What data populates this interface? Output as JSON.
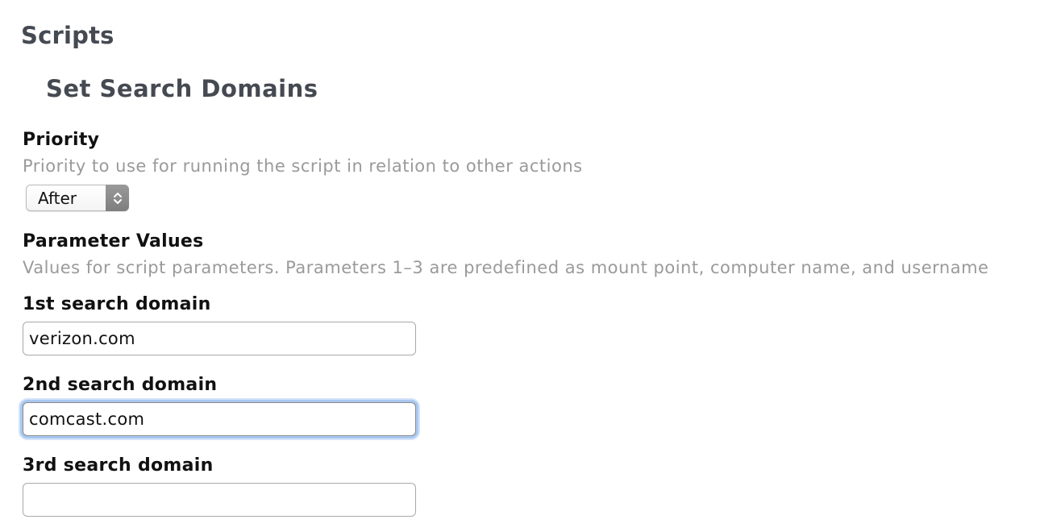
{
  "header": {
    "section_title": "Scripts",
    "item_title": "Set Search Domains"
  },
  "priority": {
    "label": "Priority",
    "description": "Priority to use for running the script in relation to other actions",
    "selected": "After"
  },
  "parameters": {
    "label": "Parameter Values",
    "description": "Values for script parameters. Parameters 1–3 are predefined as mount point, computer name, and username"
  },
  "fields": [
    {
      "label": "1st search domain",
      "value": "verizon.com",
      "focused": false
    },
    {
      "label": "2nd search domain",
      "value": "comcast.com",
      "focused": true
    },
    {
      "label": "3rd search domain",
      "value": "",
      "focused": false
    }
  ]
}
